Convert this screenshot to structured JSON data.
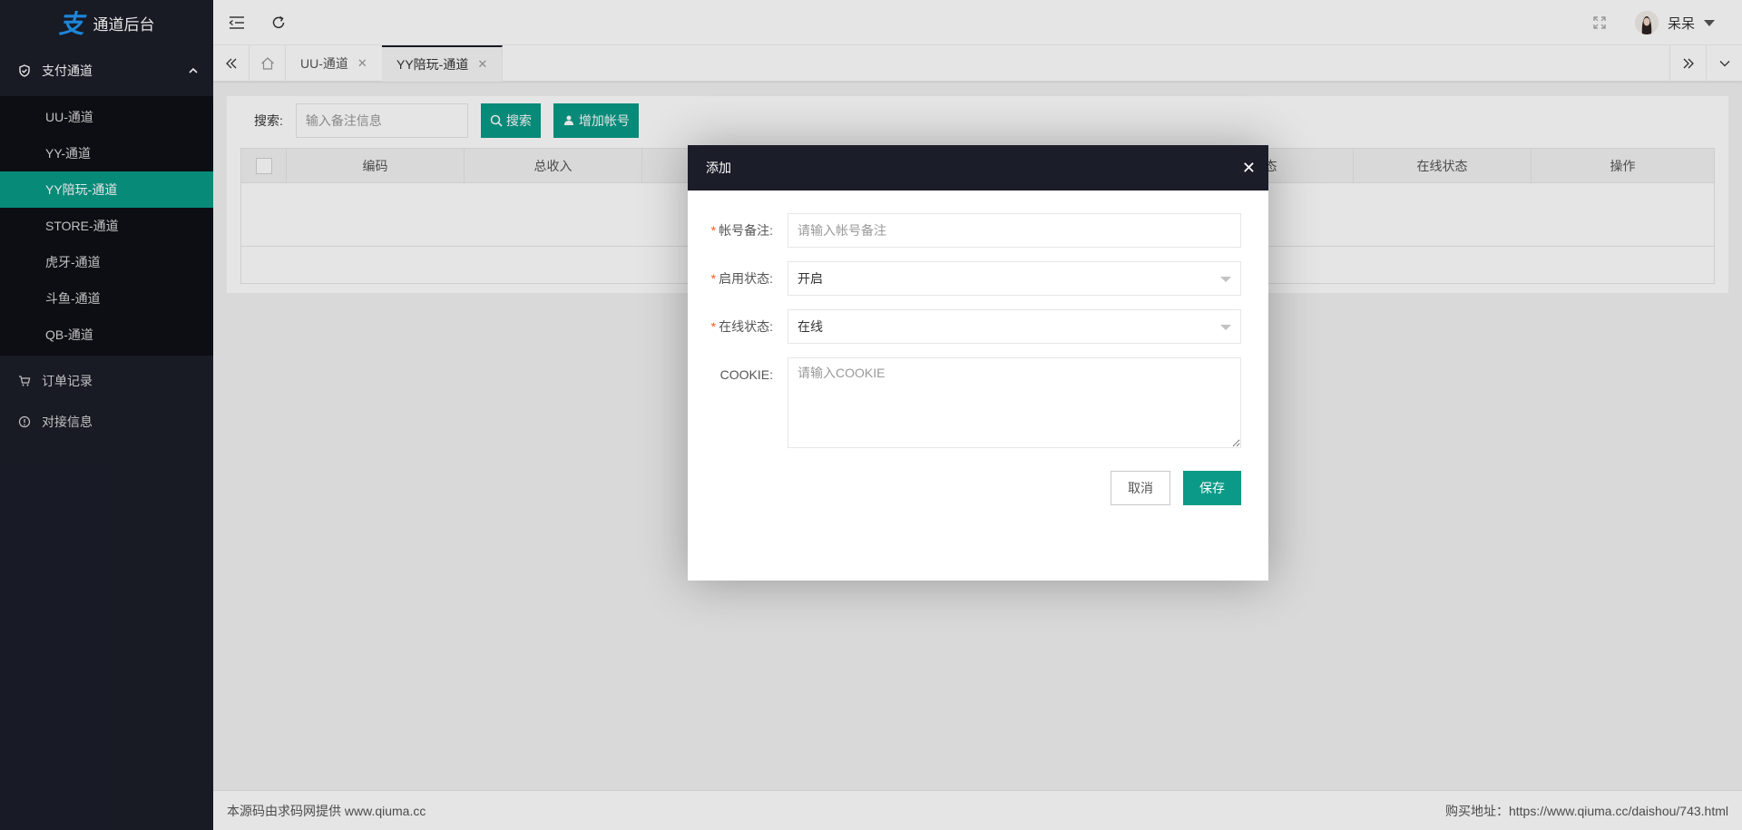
{
  "app": {
    "title": "通道后台",
    "logo_glyph": "支"
  },
  "sidebar": {
    "group": {
      "label": "支付通道",
      "icon": "shield-check-icon",
      "expanded": true
    },
    "sub_items": [
      {
        "label": "UU-通道",
        "active": false
      },
      {
        "label": "YY-通道",
        "active": false
      },
      {
        "label": "YY陪玩-通道",
        "active": true
      },
      {
        "label": "STORE-通道",
        "active": false
      },
      {
        "label": "虎牙-通道",
        "active": false
      },
      {
        "label": "斗鱼-通道",
        "active": false
      },
      {
        "label": "QB-通道",
        "active": false
      }
    ],
    "items": [
      {
        "label": "订单记录",
        "icon": "cart-icon"
      },
      {
        "label": "对接信息",
        "icon": "info-icon"
      }
    ],
    "active_color": "#0a9a87",
    "bg_color": "#1b1d29"
  },
  "header": {
    "user_name": "呆呆"
  },
  "tabs": [
    {
      "label": "UU-通道",
      "active": false
    },
    {
      "label": "YY陪玩-通道",
      "active": true
    }
  ],
  "toolbar": {
    "search_label": "搜索:",
    "search_placeholder": "输入备注信息",
    "search_button": "搜索",
    "add_button": "增加帐号"
  },
  "table": {
    "headers": [
      "",
      "编码",
      "总收入",
      "",
      "",
      "",
      "",
      "状态",
      "在线状态",
      "操作"
    ]
  },
  "footer": {
    "left": "本源码由求码网提供 www.qiuma.cc",
    "right": "购买地址：https://www.qiuma.cc/daishou/743.html"
  },
  "modal": {
    "title": "添加",
    "fields": {
      "remark": {
        "label": "帐号备注:",
        "placeholder": "请输入帐号备注",
        "value": ""
      },
      "enabled": {
        "label": "启用状态:",
        "value": "开启"
      },
      "online": {
        "label": "在线状态:",
        "value": "在线"
      },
      "cookie": {
        "label": "COOKIE:",
        "placeholder": "请输入COOKIE",
        "value": ""
      }
    },
    "cancel": "取消",
    "save": "保存"
  }
}
